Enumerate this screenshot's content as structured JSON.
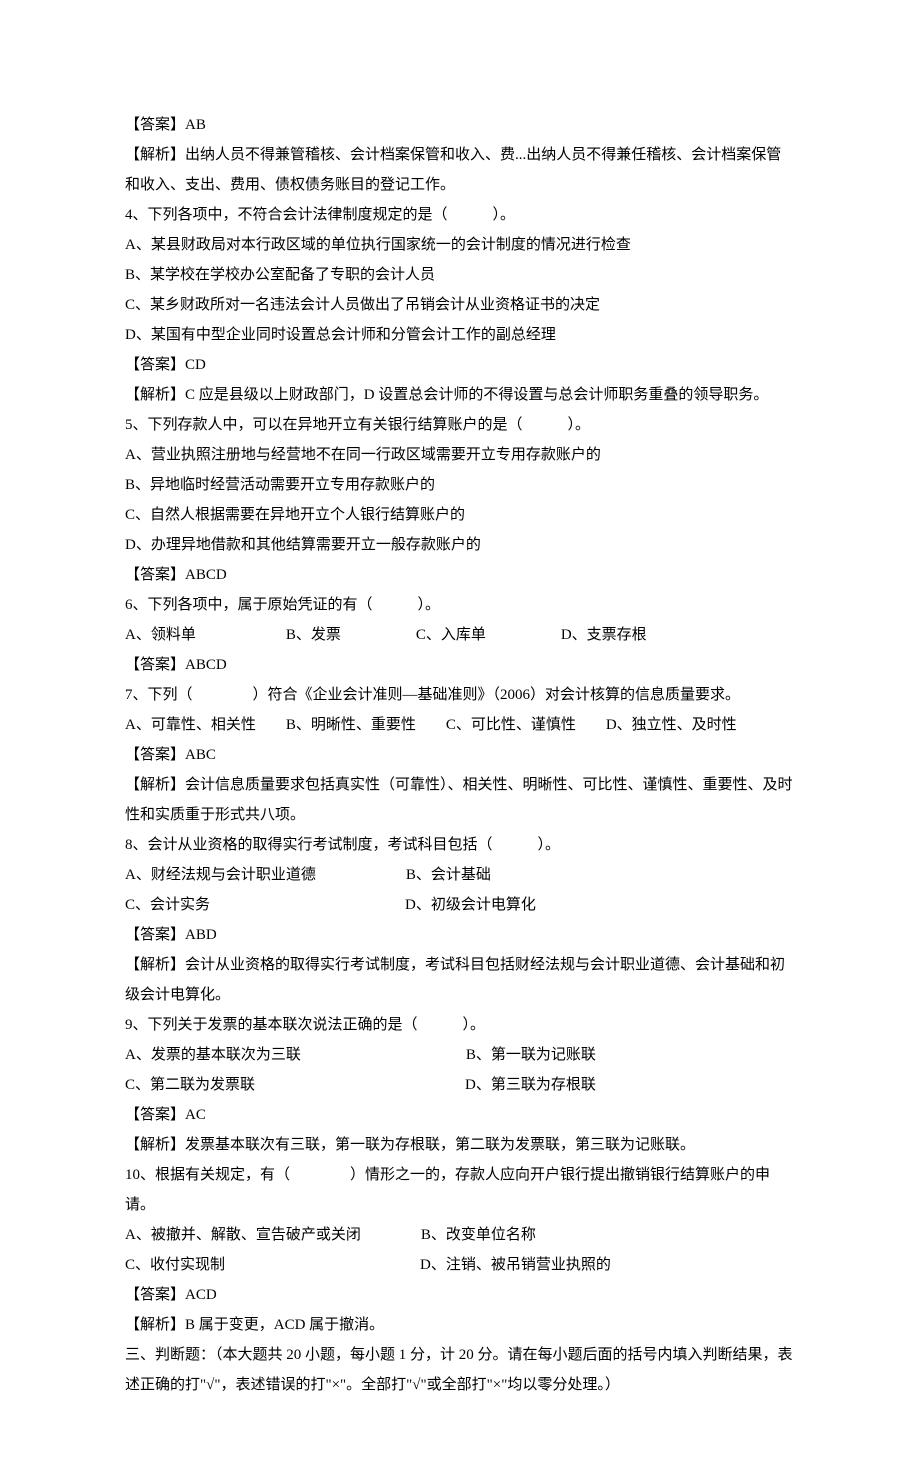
{
  "lines": [
    "【答案】AB",
    "【解析】出纳人员不得兼管稽核、会计档案保管和收入、费...出纳人员不得兼任稽核、会计档案保管和收入、支出、费用、债权债务账目的登记工作。",
    "4、下列各项中，不符合会计法律制度规定的是（　　　）。",
    "A、某县财政局对本行政区域的单位执行国家统一的会计制度的情况进行检查",
    "B、某学校在学校办公室配备了专职的会计人员",
    "C、某乡财政所对一名违法会计人员做出了吊销会计从业资格证书的决定",
    "D、某国有中型企业同时设置总会计师和分管会计工作的副总经理",
    "【答案】CD",
    "【解析】C 应是县级以上财政部门，D 设置总会计师的不得设置与总会计师职务重叠的领导职务。",
    "5、下列存款人中，可以在异地开立有关银行结算账户的是（　　　）。",
    "A、营业执照注册地与经营地不在同一行政区域需要开立专用存款账户的",
    "B、异地临时经营活动需要开立专用存款账户的",
    "C、自然人根据需要在异地开立个人银行结算账户的",
    "D、办理异地借款和其他结算需要开立一般存款账户的",
    "【答案】ABCD",
    "6、下列各项中，属于原始凭证的有（　　　）。",
    "A、领料单　　　　　　B、发票　　　　　C、入库单　　　　　D、支票存根",
    "【答案】ABCD",
    "7、下列（　　　　）符合《企业会计准则—基础准则》（2006）对会计核算的信息质量要求。",
    "A、可靠性、相关性　　B、明晰性、重要性　　C、可比性、谨慎性　　D、独立性、及时性",
    "【答案】ABC",
    "【解析】会计信息质量要求包括真实性（可靠性）、相关性、明晰性、可比性、谨慎性、重要性、及时性和实质重于形式共八项。",
    "8、会计从业资格的取得实行考试制度，考试科目包括（　　　）。",
    "A、财经法规与会计职业道德　　　　　　B、会计基础",
    "C、会计实务　　　　　　　　　　　　　D、初级会计电算化",
    "【答案】ABD",
    "【解析】会计从业资格的取得实行考试制度，考试科目包括财经法规与会计职业道德、会计基础和初级会计电算化。",
    "9、下列关于发票的基本联次说法正确的是（　　　）。",
    "A、发票的基本联次为三联　　　　　　　　　　　B、第一联为记账联",
    "C、第二联为发票联　　　　　　　　　　　　　　D、第三联为存根联",
    "【答案】AC",
    "【解析】发票基本联次有三联，第一联为存根联，第二联为发票联，第三联为记账联。",
    "10、根据有关规定，有（　　　　）情形之一的，存款人应向开户银行提出撤销银行结算账户的申请。",
    "A、被撤并、解散、宣告破产或关闭　　　　B、改变单位名称",
    "C、收付实现制　　　　　　　　　　　　　D、注销、被吊销营业执照的",
    "【答案】ACD",
    "【解析】B 属于变更，ACD 属于撤消。",
    "三、判断题：（本大题共 20 小题，每小题 1 分，计 20 分。请在每小题后面的括号内填入判断结果，表述正确的打\"√\"，表述错误的打\"×\"。全部打\"√\"或全部打\"×\"均以零分处理。）"
  ]
}
